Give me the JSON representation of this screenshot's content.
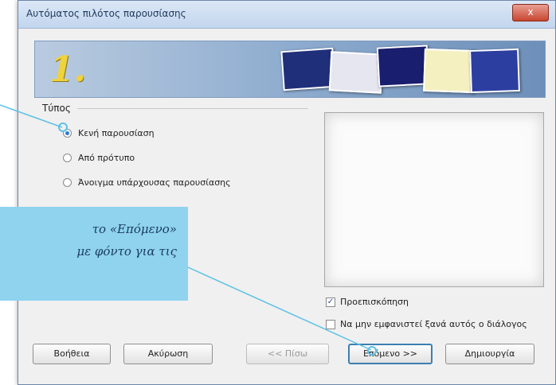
{
  "window": {
    "title": "Αυτόματος πιλότος παρουσίασης",
    "close_label": "x"
  },
  "banner": {
    "step_number": "1."
  },
  "type_group": {
    "label": "Τύπος",
    "options": [
      {
        "label": "Κενή παρουσίαση",
        "selected": true
      },
      {
        "label": "Από πρότυπο",
        "selected": false
      },
      {
        "label": "Άνοιγμα υπάρχουσας παρουσίασης",
        "selected": false
      }
    ]
  },
  "checks": {
    "preview": {
      "label": "Προεπισκόπηση",
      "checked": true
    },
    "dont_show": {
      "label": "Να μην εμφανιστεί ξανά αυτός ο διάλογος",
      "checked": false
    }
  },
  "buttons": {
    "help": "Βοήθεια",
    "cancel": "Ακύρωση",
    "back": "<< Πίσω",
    "next": "Επόμενο >>",
    "create": "Δημιουργία"
  },
  "callout": {
    "text": "το «Επόμενο»\nμε φόντο για τις"
  },
  "colors": {
    "accent": "#2e7bd8",
    "callout_bg": "#8fd3ee",
    "connector": "#5bc0e6"
  }
}
